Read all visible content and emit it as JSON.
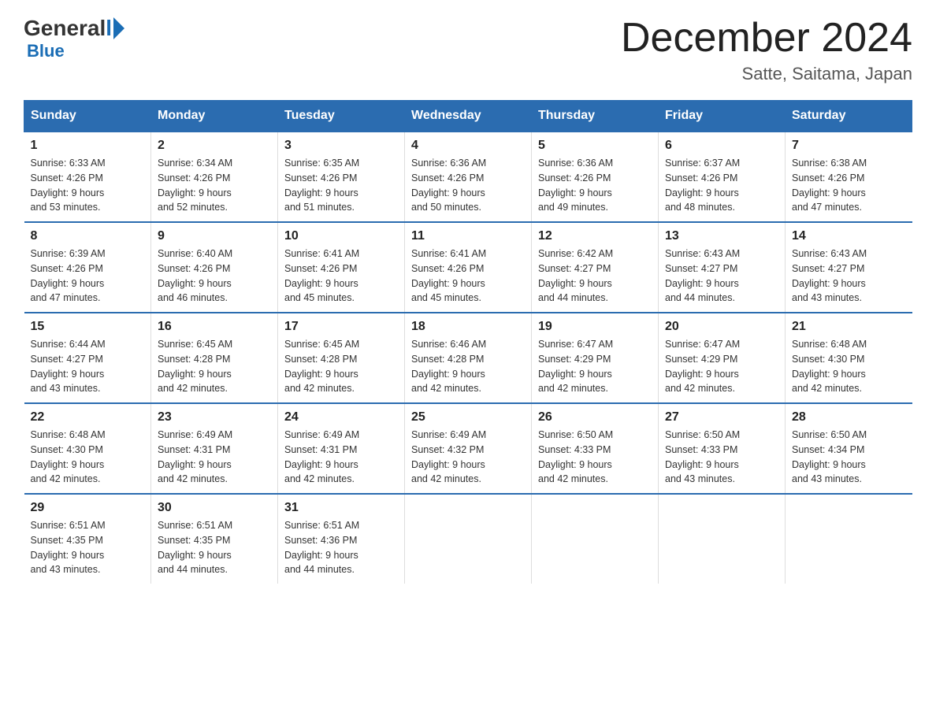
{
  "header": {
    "logo_general": "General",
    "logo_blue": "Blue",
    "month_title": "December 2024",
    "subtitle": "Satte, Saitama, Japan"
  },
  "days_of_week": [
    "Sunday",
    "Monday",
    "Tuesday",
    "Wednesday",
    "Thursday",
    "Friday",
    "Saturday"
  ],
  "weeks": [
    [
      {
        "day": "1",
        "sunrise": "6:33 AM",
        "sunset": "4:26 PM",
        "daylight": "9 hours and 53 minutes."
      },
      {
        "day": "2",
        "sunrise": "6:34 AM",
        "sunset": "4:26 PM",
        "daylight": "9 hours and 52 minutes."
      },
      {
        "day": "3",
        "sunrise": "6:35 AM",
        "sunset": "4:26 PM",
        "daylight": "9 hours and 51 minutes."
      },
      {
        "day": "4",
        "sunrise": "6:36 AM",
        "sunset": "4:26 PM",
        "daylight": "9 hours and 50 minutes."
      },
      {
        "day": "5",
        "sunrise": "6:36 AM",
        "sunset": "4:26 PM",
        "daylight": "9 hours and 49 minutes."
      },
      {
        "day": "6",
        "sunrise": "6:37 AM",
        "sunset": "4:26 PM",
        "daylight": "9 hours and 48 minutes."
      },
      {
        "day": "7",
        "sunrise": "6:38 AM",
        "sunset": "4:26 PM",
        "daylight": "9 hours and 47 minutes."
      }
    ],
    [
      {
        "day": "8",
        "sunrise": "6:39 AM",
        "sunset": "4:26 PM",
        "daylight": "9 hours and 47 minutes."
      },
      {
        "day": "9",
        "sunrise": "6:40 AM",
        "sunset": "4:26 PM",
        "daylight": "9 hours and 46 minutes."
      },
      {
        "day": "10",
        "sunrise": "6:41 AM",
        "sunset": "4:26 PM",
        "daylight": "9 hours and 45 minutes."
      },
      {
        "day": "11",
        "sunrise": "6:41 AM",
        "sunset": "4:26 PM",
        "daylight": "9 hours and 45 minutes."
      },
      {
        "day": "12",
        "sunrise": "6:42 AM",
        "sunset": "4:27 PM",
        "daylight": "9 hours and 44 minutes."
      },
      {
        "day": "13",
        "sunrise": "6:43 AM",
        "sunset": "4:27 PM",
        "daylight": "9 hours and 44 minutes."
      },
      {
        "day": "14",
        "sunrise": "6:43 AM",
        "sunset": "4:27 PM",
        "daylight": "9 hours and 43 minutes."
      }
    ],
    [
      {
        "day": "15",
        "sunrise": "6:44 AM",
        "sunset": "4:27 PM",
        "daylight": "9 hours and 43 minutes."
      },
      {
        "day": "16",
        "sunrise": "6:45 AM",
        "sunset": "4:28 PM",
        "daylight": "9 hours and 42 minutes."
      },
      {
        "day": "17",
        "sunrise": "6:45 AM",
        "sunset": "4:28 PM",
        "daylight": "9 hours and 42 minutes."
      },
      {
        "day": "18",
        "sunrise": "6:46 AM",
        "sunset": "4:28 PM",
        "daylight": "9 hours and 42 minutes."
      },
      {
        "day": "19",
        "sunrise": "6:47 AM",
        "sunset": "4:29 PM",
        "daylight": "9 hours and 42 minutes."
      },
      {
        "day": "20",
        "sunrise": "6:47 AM",
        "sunset": "4:29 PM",
        "daylight": "9 hours and 42 minutes."
      },
      {
        "day": "21",
        "sunrise": "6:48 AM",
        "sunset": "4:30 PM",
        "daylight": "9 hours and 42 minutes."
      }
    ],
    [
      {
        "day": "22",
        "sunrise": "6:48 AM",
        "sunset": "4:30 PM",
        "daylight": "9 hours and 42 minutes."
      },
      {
        "day": "23",
        "sunrise": "6:49 AM",
        "sunset": "4:31 PM",
        "daylight": "9 hours and 42 minutes."
      },
      {
        "day": "24",
        "sunrise": "6:49 AM",
        "sunset": "4:31 PM",
        "daylight": "9 hours and 42 minutes."
      },
      {
        "day": "25",
        "sunrise": "6:49 AM",
        "sunset": "4:32 PM",
        "daylight": "9 hours and 42 minutes."
      },
      {
        "day": "26",
        "sunrise": "6:50 AM",
        "sunset": "4:33 PM",
        "daylight": "9 hours and 42 minutes."
      },
      {
        "day": "27",
        "sunrise": "6:50 AM",
        "sunset": "4:33 PM",
        "daylight": "9 hours and 43 minutes."
      },
      {
        "day": "28",
        "sunrise": "6:50 AM",
        "sunset": "4:34 PM",
        "daylight": "9 hours and 43 minutes."
      }
    ],
    [
      {
        "day": "29",
        "sunrise": "6:51 AM",
        "sunset": "4:35 PM",
        "daylight": "9 hours and 43 minutes."
      },
      {
        "day": "30",
        "sunrise": "6:51 AM",
        "sunset": "4:35 PM",
        "daylight": "9 hours and 44 minutes."
      },
      {
        "day": "31",
        "sunrise": "6:51 AM",
        "sunset": "4:36 PM",
        "daylight": "9 hours and 44 minutes."
      },
      null,
      null,
      null,
      null
    ]
  ],
  "labels": {
    "sunrise": "Sunrise:",
    "sunset": "Sunset:",
    "daylight": "Daylight:"
  }
}
